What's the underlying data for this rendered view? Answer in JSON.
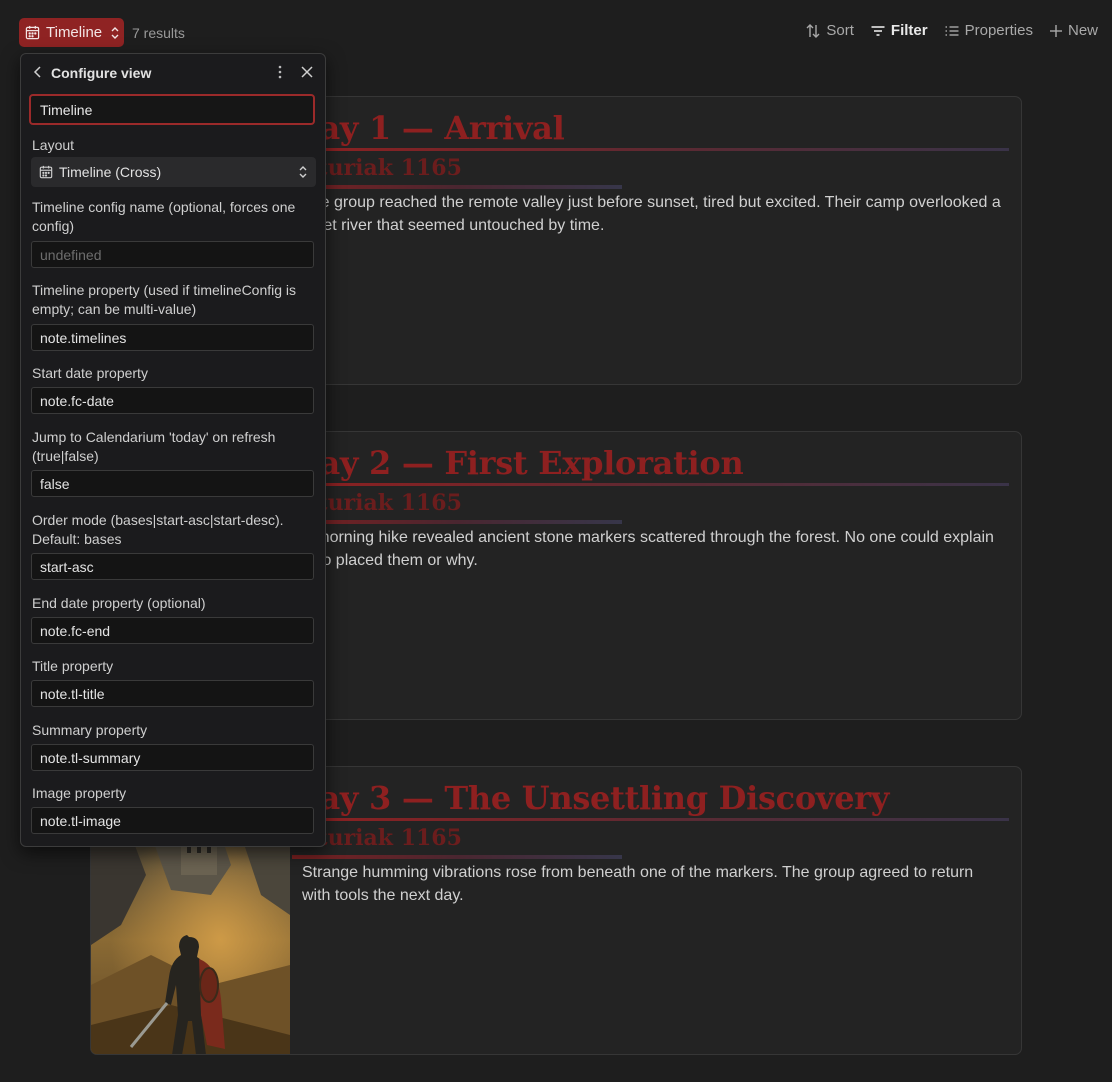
{
  "toolbar": {
    "view_label": "Timeline",
    "results": "7 results",
    "sort": "Sort",
    "filter": "Filter",
    "properties": "Properties",
    "new": "New"
  },
  "cards": [
    {
      "title": "Day 1 — Arrival",
      "date": "Alturiak 1165",
      "summary": "The group reached the remote valley just before sunset, tired but excited. Their camp overlooked a quiet river that seemed untouched by time."
    },
    {
      "title": "Day 2 — First Exploration",
      "date": "Alturiak 1165",
      "summary": "A morning hike revealed ancient stone markers scattered through the forest. No one could explain who placed them or why."
    },
    {
      "title": "Day 3 — The Unsettling Discovery",
      "date": "Alturiak 1165",
      "summary": "Strange humming vibrations rose from beneath one of the markers. The group agreed to return with tools the next day."
    }
  ],
  "panel": {
    "title": "Configure view",
    "view_name": "Timeline",
    "layout_label": "Layout",
    "layout_value": "Timeline (Cross)",
    "fields": [
      {
        "label": "Timeline config name (optional, forces one config)",
        "value": "",
        "placeholder": "undefined"
      },
      {
        "label": "Timeline property (used if timelineConfig is empty; can be multi-value)",
        "value": "note.timelines",
        "placeholder": ""
      },
      {
        "label": "Start date property",
        "value": "note.fc-date",
        "placeholder": ""
      },
      {
        "label": "Jump to Calendarium 'today' on refresh (true|false)",
        "value": "false",
        "placeholder": ""
      },
      {
        "label": "Order mode (bases|start-asc|start-desc). Default: bases",
        "value": "start-asc",
        "placeholder": ""
      },
      {
        "label": "End date property (optional)",
        "value": "note.fc-end",
        "placeholder": ""
      },
      {
        "label": "Title property",
        "value": "note.tl-title",
        "placeholder": ""
      },
      {
        "label": "Summary property",
        "value": "note.tl-summary",
        "placeholder": ""
      },
      {
        "label": "Image property",
        "value": "note.tl-image",
        "placeholder": ""
      }
    ]
  },
  "colors": {
    "accent": "#8f2323",
    "title_red": "#8e2020",
    "background": "#1e1e1e",
    "card": "#232323"
  }
}
